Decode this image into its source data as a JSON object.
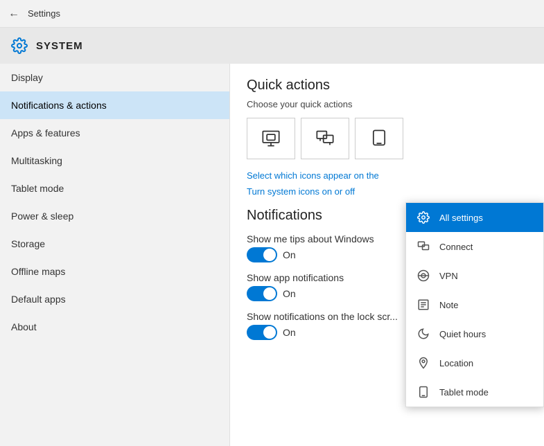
{
  "titleBar": {
    "title": "Settings",
    "backLabel": "←"
  },
  "header": {
    "systemLabel": "SYSTEM"
  },
  "sidebar": {
    "items": [
      {
        "id": "display",
        "label": "Display"
      },
      {
        "id": "notifications",
        "label": "Notifications & actions",
        "active": true
      },
      {
        "id": "apps",
        "label": "Apps & features"
      },
      {
        "id": "multitasking",
        "label": "Multitasking"
      },
      {
        "id": "tablet",
        "label": "Tablet mode"
      },
      {
        "id": "power",
        "label": "Power & sleep"
      },
      {
        "id": "storage",
        "label": "Storage"
      },
      {
        "id": "offline-maps",
        "label": "Offline maps"
      },
      {
        "id": "default-apps",
        "label": "Default apps"
      },
      {
        "id": "about",
        "label": "About"
      }
    ]
  },
  "content": {
    "quickActions": {
      "title": "Quick actions",
      "subtitle": "Choose your quick actions",
      "tiles": [
        {
          "icon": "screen-project"
        },
        {
          "icon": "connect-display"
        },
        {
          "icon": "screen-rotate"
        }
      ],
      "link1": "Select which icons appear on the",
      "link2": "Turn system icons on or off"
    },
    "notifications": {
      "title": "Notifications",
      "items": [
        {
          "label": "Show me tips about Windows",
          "state": "On",
          "enabled": true
        },
        {
          "label": "Show app notifications",
          "state": "On",
          "enabled": true
        },
        {
          "label": "Show notifications on the lock scr...",
          "state": "On",
          "enabled": true
        }
      ]
    }
  },
  "dropdown": {
    "items": [
      {
        "id": "all-settings",
        "label": "All settings",
        "selected": true
      },
      {
        "id": "connect",
        "label": "Connect",
        "selected": false
      },
      {
        "id": "vpn",
        "label": "VPN",
        "selected": false
      },
      {
        "id": "note",
        "label": "Note",
        "selected": false
      },
      {
        "id": "quiet-hours",
        "label": "Quiet hours",
        "selected": false
      },
      {
        "id": "location",
        "label": "Location",
        "selected": false
      },
      {
        "id": "tablet-mode",
        "label": "Tablet mode",
        "selected": false
      }
    ]
  }
}
